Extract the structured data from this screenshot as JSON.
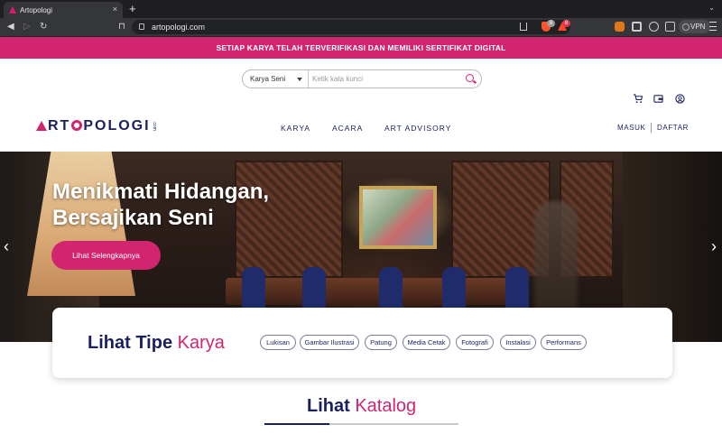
{
  "browser": {
    "tab_title": "Artopologi",
    "tab_close": "×",
    "new_tab": "+",
    "url": "artopologi.com",
    "vpn_label": "VPN",
    "shield_badge": "6",
    "rewards_badge": "8"
  },
  "site": {
    "banner_text": "SETIAP KARYA TELAH TERVERIFIKASI DAN MEMILIKI SERTIFIKAT DIGITAL",
    "search": {
      "category_value": "Karya Seni",
      "placeholder": "Ketik kata kunci"
    },
    "logo": {
      "left": "RT",
      "right": "POLOGI",
      "suffix": ".com"
    },
    "nav": [
      "KARYA",
      "ACARA",
      "ART ADVISORY"
    ],
    "auth": {
      "login": "MASUK",
      "register": "DAFTAR"
    },
    "hero": {
      "title": "Menikmati Hidangan, Bersajikan Seni",
      "cta": "Lihat Selengkapnya",
      "prev": "‹",
      "next": "›"
    },
    "types": {
      "title_main": "Lihat Tipe ",
      "title_accent": "Karya",
      "chips": [
        "Lukisan",
        "Gambar Ilustrasi",
        "Patung",
        "Media Cetak",
        "Fotografi",
        "Instalasi",
        "Performans"
      ]
    },
    "catalog": {
      "title_main": "Lihat ",
      "title_accent": "Katalog"
    }
  },
  "colors": {
    "brand_pink": "#d1256f",
    "brand_navy": "#1b1f5e"
  }
}
